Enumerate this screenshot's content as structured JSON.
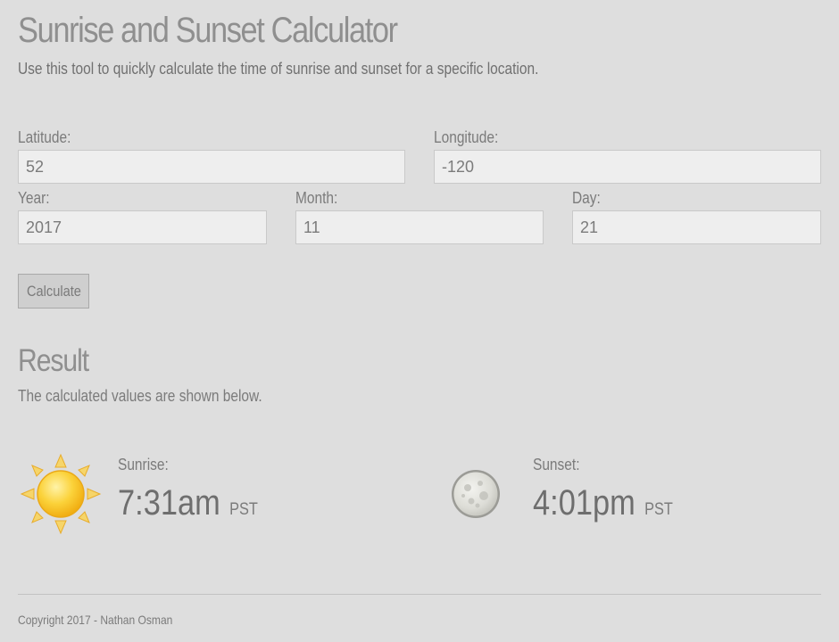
{
  "header": {
    "title": "Sunrise and Sunset Calculator",
    "subtitle": "Use this tool to quickly calculate the time of sunrise and sunset for a specific location."
  },
  "form": {
    "latitude": {
      "label": "Latitude:",
      "value": "52"
    },
    "longitude": {
      "label": "Longitude:",
      "value": "-120"
    },
    "year": {
      "label": "Year:",
      "value": "2017"
    },
    "month": {
      "label": "Month:",
      "value": "11"
    },
    "day": {
      "label": "Day:",
      "value": "21"
    },
    "calculate_label": "Calculate"
  },
  "result": {
    "heading": "Result",
    "description": "The calculated values are shown below.",
    "sunrise": {
      "label": "Sunrise:",
      "time": "7:31am",
      "zone": "PST",
      "icon": "sun-icon"
    },
    "sunset": {
      "label": "Sunset:",
      "time": "4:01pm",
      "zone": "PST",
      "icon": "moon-icon"
    }
  },
  "footer": {
    "copyright": "Copyright 2017 - Nathan Osman"
  },
  "colors": {
    "background": "#dedede",
    "title": "#8f8f8f",
    "text": "#7b7b7b",
    "sun": "#f7c325",
    "moon": "#e6e6e0"
  }
}
